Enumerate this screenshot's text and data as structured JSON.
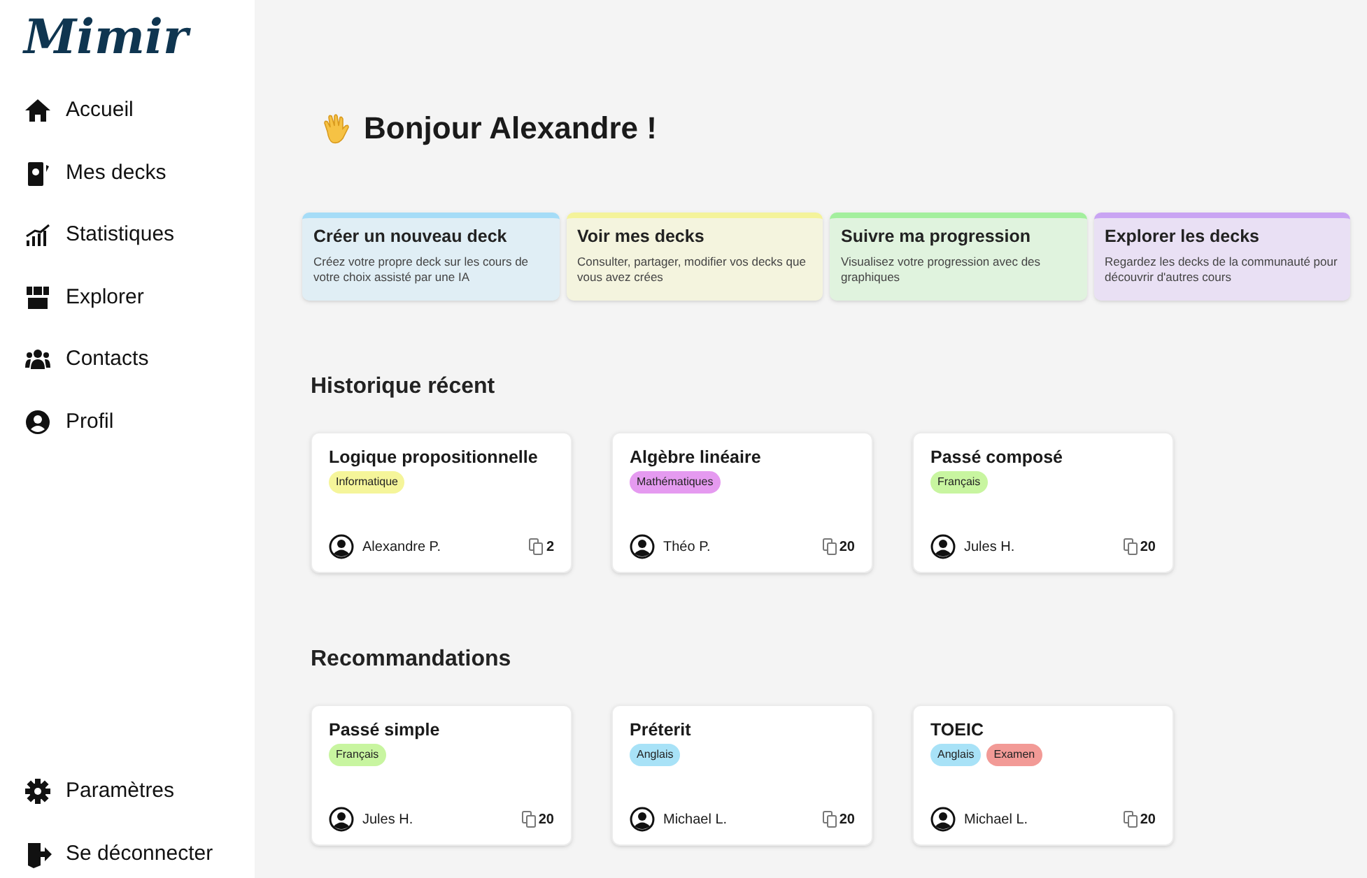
{
  "logo": "Mimir",
  "sidebar": {
    "items": [
      {
        "label": "Accueil"
      },
      {
        "label": "Mes decks"
      },
      {
        "label": "Statistiques"
      },
      {
        "label": "Explorer"
      },
      {
        "label": "Contacts"
      },
      {
        "label": "Profil"
      }
    ],
    "bottom_items": [
      {
        "label": "Paramètres"
      },
      {
        "label": "Se déconnecter"
      }
    ]
  },
  "greeting": "Bonjour Alexandre !",
  "quick_actions": [
    {
      "title": "Créer un nouveau deck",
      "description": "Créez votre propre deck sur les cours de votre choix assisté par une IA",
      "color": "#a5dcf7"
    },
    {
      "title": "Voir mes decks",
      "description": "Consulter, partager, modifier vos decks que vous avez crées",
      "color": "#f4f39a"
    },
    {
      "title": "Suivre ma progression",
      "description": "Visualisez votre progression avec des graphiques",
      "color": "#a3ef9d"
    },
    {
      "title": "Explorer les decks",
      "description": "Regardez les decks de la communauté pour découvrir d'autres cours",
      "color": "#c9a4f3"
    }
  ],
  "sections": [
    {
      "title": "Historique récent",
      "decks": [
        {
          "title": "Logique propositionnelle",
          "tags": [
            {
              "label": "Informatique",
              "color": "#f5f59a"
            }
          ],
          "author": "Alexandre P.",
          "count": "2"
        },
        {
          "title": "Algèbre linéaire",
          "tags": [
            {
              "label": "Mathématiques",
              "color": "#e59af0"
            }
          ],
          "author": "Théo P.",
          "count": "20"
        },
        {
          "title": "Passé composé",
          "tags": [
            {
              "label": "Français",
              "color": "#c8f5a0"
            }
          ],
          "author": "Jules H.",
          "count": "20"
        }
      ]
    },
    {
      "title": "Recommandations",
      "decks": [
        {
          "title": "Passé simple",
          "tags": [
            {
              "label": "Français",
              "color": "#c8f5a0"
            }
          ],
          "author": "Jules H.",
          "count": "20"
        },
        {
          "title": "Préterit",
          "tags": [
            {
              "label": "Anglais",
              "color": "#a8e2f7"
            }
          ],
          "author": "Michael L.",
          "count": "20"
        },
        {
          "title": "TOEIC",
          "tags": [
            {
              "label": "Anglais",
              "color": "#a8e2f7"
            },
            {
              "label": "Examen",
              "color": "#f29a96"
            }
          ],
          "author": "Michael L.",
          "count": "20"
        }
      ]
    }
  ]
}
